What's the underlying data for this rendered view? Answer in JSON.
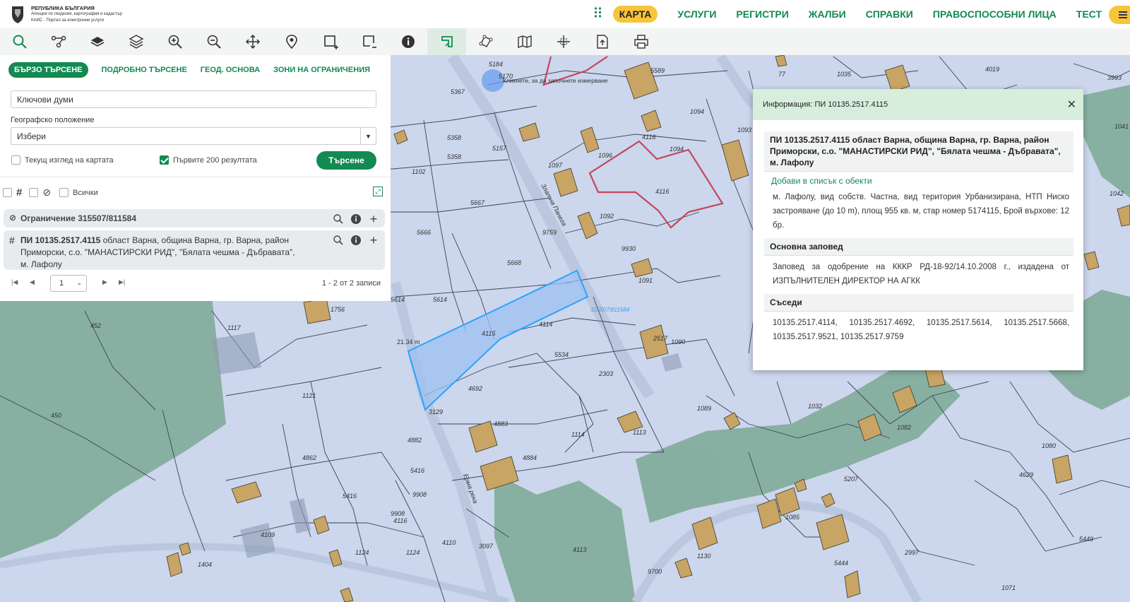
{
  "header": {
    "logo_title": "РЕПУБЛИКА БЪЛГАРИЯ",
    "logo_sub1": "Агенция по геодезия, картография и кадастър",
    "logo_sub2": "КАИС - Портал за електронни услуги",
    "apps_icon": "grid-icon",
    "nav": [
      "КАРТА",
      "УСЛУГИ",
      "РЕГИСТРИ",
      "ЖАЛБИ",
      "СПРАВКИ",
      "ПРАВОСПОСОБНИ ЛИЦА",
      "ТЕСТ"
    ],
    "accent": "#138a52",
    "highlight": "#f8c53a"
  },
  "toolbar": {
    "tools": [
      "search-icon",
      "route-icon",
      "layer-icon",
      "layers-icon",
      "zoom-in-icon",
      "zoom-out-icon",
      "pan-icon",
      "pin-icon",
      "draw-polygon-icon",
      "draw-rectangle-icon",
      "info-icon",
      "measure-icon",
      "edit-nodes-icon",
      "map-icon",
      "crosshair-icon",
      "export-icon",
      "print-icon"
    ],
    "active_tool": "measure-icon"
  },
  "panel": {
    "tabs": [
      "БЪРЗО ТЪРСЕНЕ",
      "ПОДРОБНО ТЪРСЕНЕ",
      "ГЕОД. ОСНОВА",
      "ЗОНИ НА ОГРАНИЧЕНИЯ"
    ],
    "keywords_placeholder": "Ключови думи",
    "geo_label": "Географско положение",
    "geo_value": "Избери",
    "current_view_label": "Текущ изглед на картата",
    "current_view_checked": false,
    "first200_label": "Първите 200 резултата",
    "first200_checked": true,
    "search_button": "Търсене",
    "all_label": "Всички",
    "results": [
      {
        "title": "Ограничение 315507/811584",
        "icon": "no-entry-icon"
      },
      {
        "title": "ПИ 10135.2517.4115",
        "description": "област Варна, община Варна, гр. Варна, район Приморски, с.о. \"МАНАСТИРСКИ РИД\", \"Бялата чешма - Дъбравата\", м. Лафолу",
        "icon": "hash-icon"
      }
    ],
    "page": "1",
    "records_info": "1 - 2 от 2 записи"
  },
  "info": {
    "header": "Информация: ПИ 10135.2517.4115",
    "title": "ПИ 10135.2517.4115 област Варна, община Варна, гр. Варна, район Приморски, с.о. \"МАНАСТИРСКИ РИД\", \"Бялата чешма - Дъбравата\", м. Лафолу",
    "add_link": "Добави в списък с обекти",
    "details": "м. Лафолу, вид собств. Частна, вид територия Урбанизирана, НТП Ниско застрояване (до 10 m), площ 955 кв. м, стар номер 5174115, Брой върхове: 12 бр.",
    "section_order": "Основна заповед",
    "order_text": "Заповед за одобрение на КККР РД-18-92/14.10.2008 г., издадена от ИЗПЪЛНИТЕЛЕН ДИРЕКТОР НА АГКК",
    "section_neighbors": "Съседи",
    "neighbors": "10135.2517.4114, 10135.2517.4692, 10135.2517.5614, 10135.2517.5668, 10135.2517.9521, 10135.2517.9759"
  },
  "map": {
    "measure_hint": "Кликнете, за да започнете измерване",
    "measure_length": "21.34 m",
    "selected_parcel": "4115",
    "restriction_label": "315507/811584",
    "streets": [
      "Златна Панега",
      "Ерма река"
    ],
    "parcel_numbers": [
      "5170",
      "5589",
      "5184",
      "5367",
      "5358",
      "5358",
      "5157",
      "1097",
      "1096",
      "1094",
      "1094",
      "1093",
      "4116",
      "4116",
      "1102",
      "5667",
      "5666",
      "9759",
      "1092",
      "9930",
      "5668",
      "1091",
      "5614",
      "5614",
      "4115",
      "4114",
      "5534",
      "2303",
      "1090",
      "2517",
      "4692",
      "3129",
      "1089",
      "1121",
      "1117",
      "1756",
      "452",
      "450",
      "4862",
      "4882",
      "4883",
      "4884",
      "5416",
      "5416",
      "9908",
      "9908",
      "4116",
      "1114",
      "1113",
      "4109",
      "1404",
      "1124",
      "1124",
      "4110",
      "3097",
      "4113",
      "9700",
      "1130",
      "2997",
      "5207",
      "1085",
      "5444",
      "4629",
      "1080",
      "1071",
      "5449",
      "1082",
      "1032",
      "77",
      "1035",
      "4019",
      "3993",
      "1041",
      "1042"
    ],
    "land_color": "#ccd6ec",
    "forest_color": "#7ba995",
    "building_color": "#c8a465",
    "selection_color": "#2aa3ff",
    "restriction_color": "#c0485c"
  }
}
